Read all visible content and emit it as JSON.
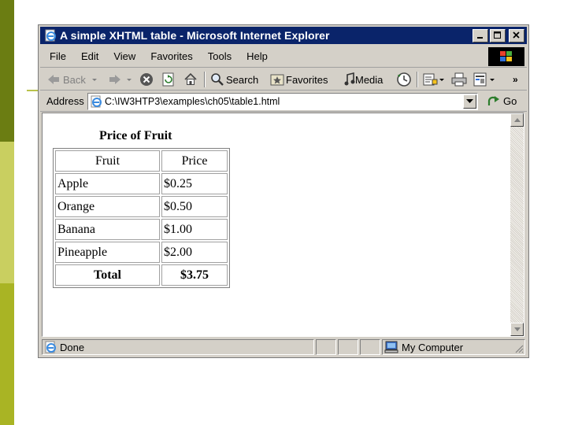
{
  "window": {
    "title": "A simple XHTML table - Microsoft Internet Explorer"
  },
  "menu": [
    "File",
    "Edit",
    "View",
    "Favorites",
    "Tools",
    "Help"
  ],
  "toolbar": {
    "back_label": "Back",
    "search_label": "Search",
    "favorites_label": "Favorites",
    "media_label": "Media",
    "more": "»"
  },
  "address": {
    "label": "Address",
    "value": "C:\\IW3HTP3\\examples\\ch05\\table1.html",
    "go_label": "Go"
  },
  "page": {
    "caption": "Price of Fruit",
    "table": {
      "headers": [
        "Fruit",
        "Price"
      ],
      "rows": [
        [
          "Apple",
          "$0.25"
        ],
        [
          "Orange",
          "$0.50"
        ],
        [
          "Banana",
          "$1.00"
        ],
        [
          "Pineapple",
          "$2.00"
        ]
      ],
      "footer": [
        "Total",
        "$3.75"
      ]
    }
  },
  "status": {
    "text": "Done",
    "zone": "My Computer"
  },
  "colors": {
    "titlebar": "#0a246a",
    "chrome": "#d4d0c8",
    "deco_dark": "#6b7d12",
    "deco_light": "#c9cf60"
  }
}
